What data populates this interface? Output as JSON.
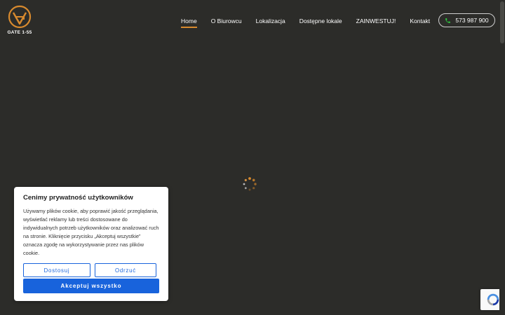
{
  "logo": {
    "text": "GATE 1-55",
    "icon": "gate-logo-icon",
    "color": "#d88a2e"
  },
  "nav": {
    "items": [
      {
        "label": "Home",
        "active": true
      },
      {
        "label": "O Biurowcu",
        "active": false
      },
      {
        "label": "Lokalizacja",
        "active": false
      },
      {
        "label": "Dostępne lokale",
        "active": false
      },
      {
        "label": "ZAINWESTUJ!",
        "active": false
      },
      {
        "label": "Kontakt",
        "active": false
      }
    ],
    "active_color": "#d88a2e"
  },
  "phone": {
    "label": "573 987 900",
    "icon": "phone-icon",
    "icon_color": "#2ecc40"
  },
  "loader": {
    "icon": "spinner-icon"
  },
  "cookie": {
    "title": "Cenimy prywatność użytkowników",
    "text": "Używamy plików cookie, aby poprawić jakość przeglądania, wyświetlać reklamy lub treści dostosowane do indywidualnych potrzeb użytkowników oraz analizować ruch na stronie. Kliknięcie przycisku „Akceptuj wszystkie” oznacza zgodę na wykorzystywanie przez nas plików cookie.",
    "customize_label": "Dostosuj",
    "reject_label": "Odrzuć",
    "accept_label": "Akceptuj wszystko",
    "accent_color": "#1863dc"
  },
  "recaptcha": {
    "icon": "recaptcha-icon"
  }
}
